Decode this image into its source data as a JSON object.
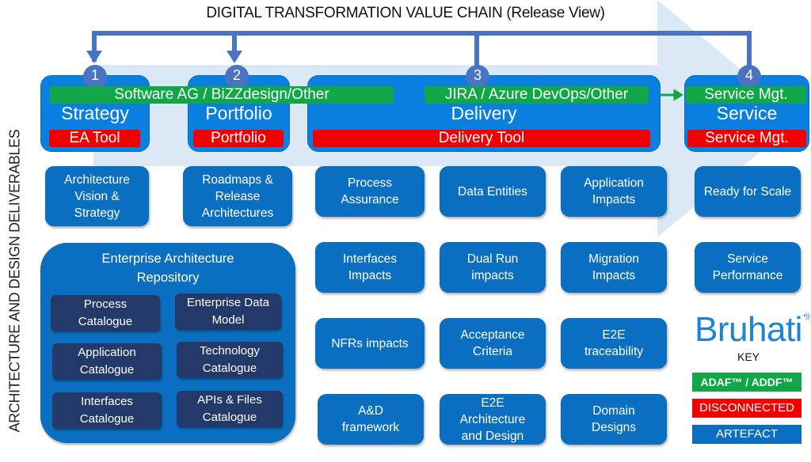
{
  "title": "DIGITAL TRANSFORMATION VALUE CHAIN (Release View)",
  "side_label": "ARCHITECTURE AND DESIGN DELIVERABLES",
  "colors": {
    "stage_blue": "#0a7fe0",
    "artefact_blue": "#0a6fc0",
    "catalogue_navy": "#23396a",
    "adaf_green": "#10a846",
    "disconnected_red": "#f20000",
    "connector_blue": "#4a73c3",
    "brand_blue": "#1a84d6"
  },
  "stages": [
    {
      "number": "1",
      "name": "Strategy",
      "tool": "EA Tool"
    },
    {
      "number": "2",
      "name": "Portfolio",
      "tool": "Portfolio"
    },
    {
      "number": "3",
      "name": "Delivery",
      "tool": "Delivery Tool"
    },
    {
      "number": "4",
      "name": "Service",
      "tool": "Service Mgt."
    }
  ],
  "integrations": [
    {
      "label": "Software AG / BiZZdesign/Other"
    },
    {
      "label": "JIRA / Azure DevOps/Other"
    },
    {
      "label": "Service Mgt."
    }
  ],
  "strategy_cards": [
    "Architecture Vision & Strategy"
  ],
  "portfolio_cards": [
    "Roadmaps & Release Architectures"
  ],
  "repository": {
    "title": "Enterprise Architecture Repository",
    "catalogues": [
      "Process Catalogue",
      "Enterprise Data Model",
      "Application Catalogue",
      "Technology Catalogue",
      "Interfaces Catalogue",
      "APIs & Files Catalogue"
    ]
  },
  "delivery_cards": [
    "Process Assurance",
    "Data Entities",
    "Application Impacts",
    "Interfaces Impacts",
    "Dual Run impacts",
    "Migration Impacts",
    "NFRs impacts",
    "Acceptance Criteria",
    "E2E traceability",
    "A&D framework",
    "E2E Architecture and Design",
    "Domain Designs"
  ],
  "service_cards": [
    "Ready for Scale",
    "Service Performance"
  ],
  "brand": {
    "name": "Bruhati",
    "mark": "•))"
  },
  "key": {
    "label": "KEY",
    "items": [
      {
        "label": "ADAF™ / ADDF™",
        "color": "#10a846"
      },
      {
        "label": "DISCONNECTED",
        "color": "#f20000"
      },
      {
        "label": "ARTEFACT",
        "color": "#0a6fc0"
      }
    ]
  }
}
